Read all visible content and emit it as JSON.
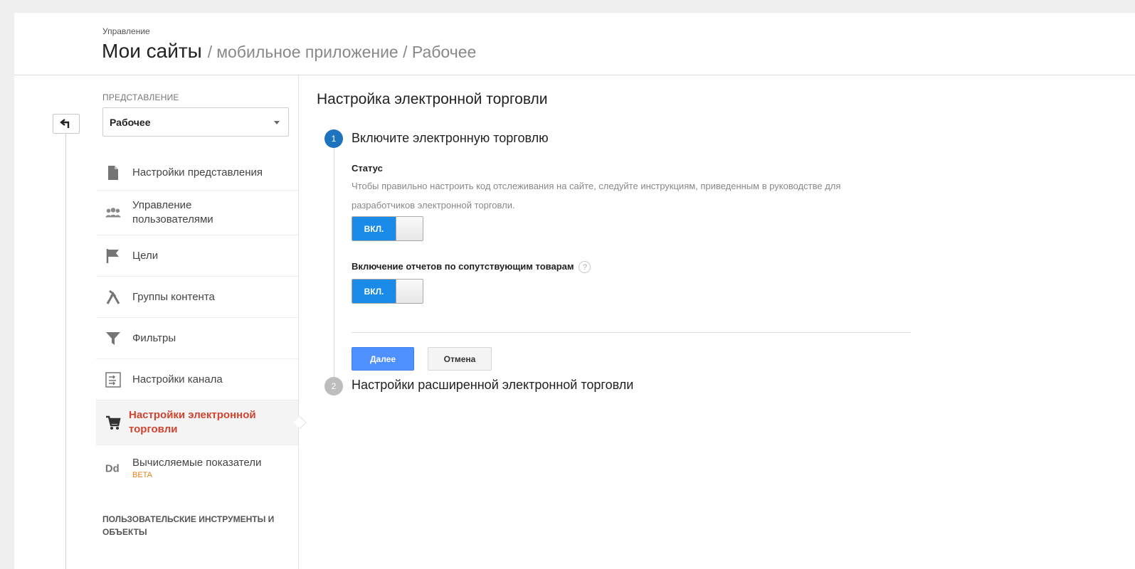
{
  "header": {
    "breadcrumb_top": "Управление",
    "title": "Мои сайты",
    "separator": "/",
    "path": "мобильное приложение / Рабочее"
  },
  "rail": {
    "back_icon": "back-arrow-icon"
  },
  "sidebar": {
    "view_label": "ПРЕДСТАВЛЕНИЕ",
    "view_select": {
      "value": "Рабочее"
    },
    "items": [
      {
        "label": "Настройки представления",
        "icon": "document-icon"
      },
      {
        "label": "Управление пользователями",
        "icon": "users-icon"
      },
      {
        "label": "Цели",
        "icon": "flag-icon"
      },
      {
        "label": "Группы контента",
        "icon": "content-groups-icon"
      },
      {
        "label": "Фильтры",
        "icon": "filter-icon"
      },
      {
        "label": "Настройки канала",
        "icon": "channel-settings-icon"
      },
      {
        "label": "Настройки электронной торговли",
        "icon": "cart-icon",
        "active": true
      },
      {
        "label": "Вычисляемые показатели",
        "badge": "BETA",
        "icon": "calculated-metrics-icon"
      }
    ],
    "tools_heading": "ПОЛЬЗОВАТЕЛЬСКИЕ ИНСТРУМЕНТЫ И ОБЪЕКТЫ"
  },
  "main": {
    "title": "Настройка электронной торговли",
    "step1": {
      "number": "1",
      "title": "Включите электронную торговлю",
      "status_label": "Статус",
      "status_desc": "Чтобы правильно настроить код отслеживания на сайте, следуйте инструкциям, приведенным в руководстве для разработчиков электронной торговли.",
      "toggle1_label": "ВКЛ.",
      "related_label": "Включение отчетов по сопутствующим товарам",
      "help": "?",
      "toggle2_label": "ВКЛ.",
      "next_button": "Далее",
      "cancel_button": "Отмена"
    },
    "step2": {
      "number": "2",
      "title": "Настройки расширенной электронной торговли"
    }
  },
  "colors": {
    "accent_blue": "#1a8ae8",
    "active_red": "#d0432f",
    "beta_orange": "#e3831e",
    "step_blue": "#1e73be"
  }
}
